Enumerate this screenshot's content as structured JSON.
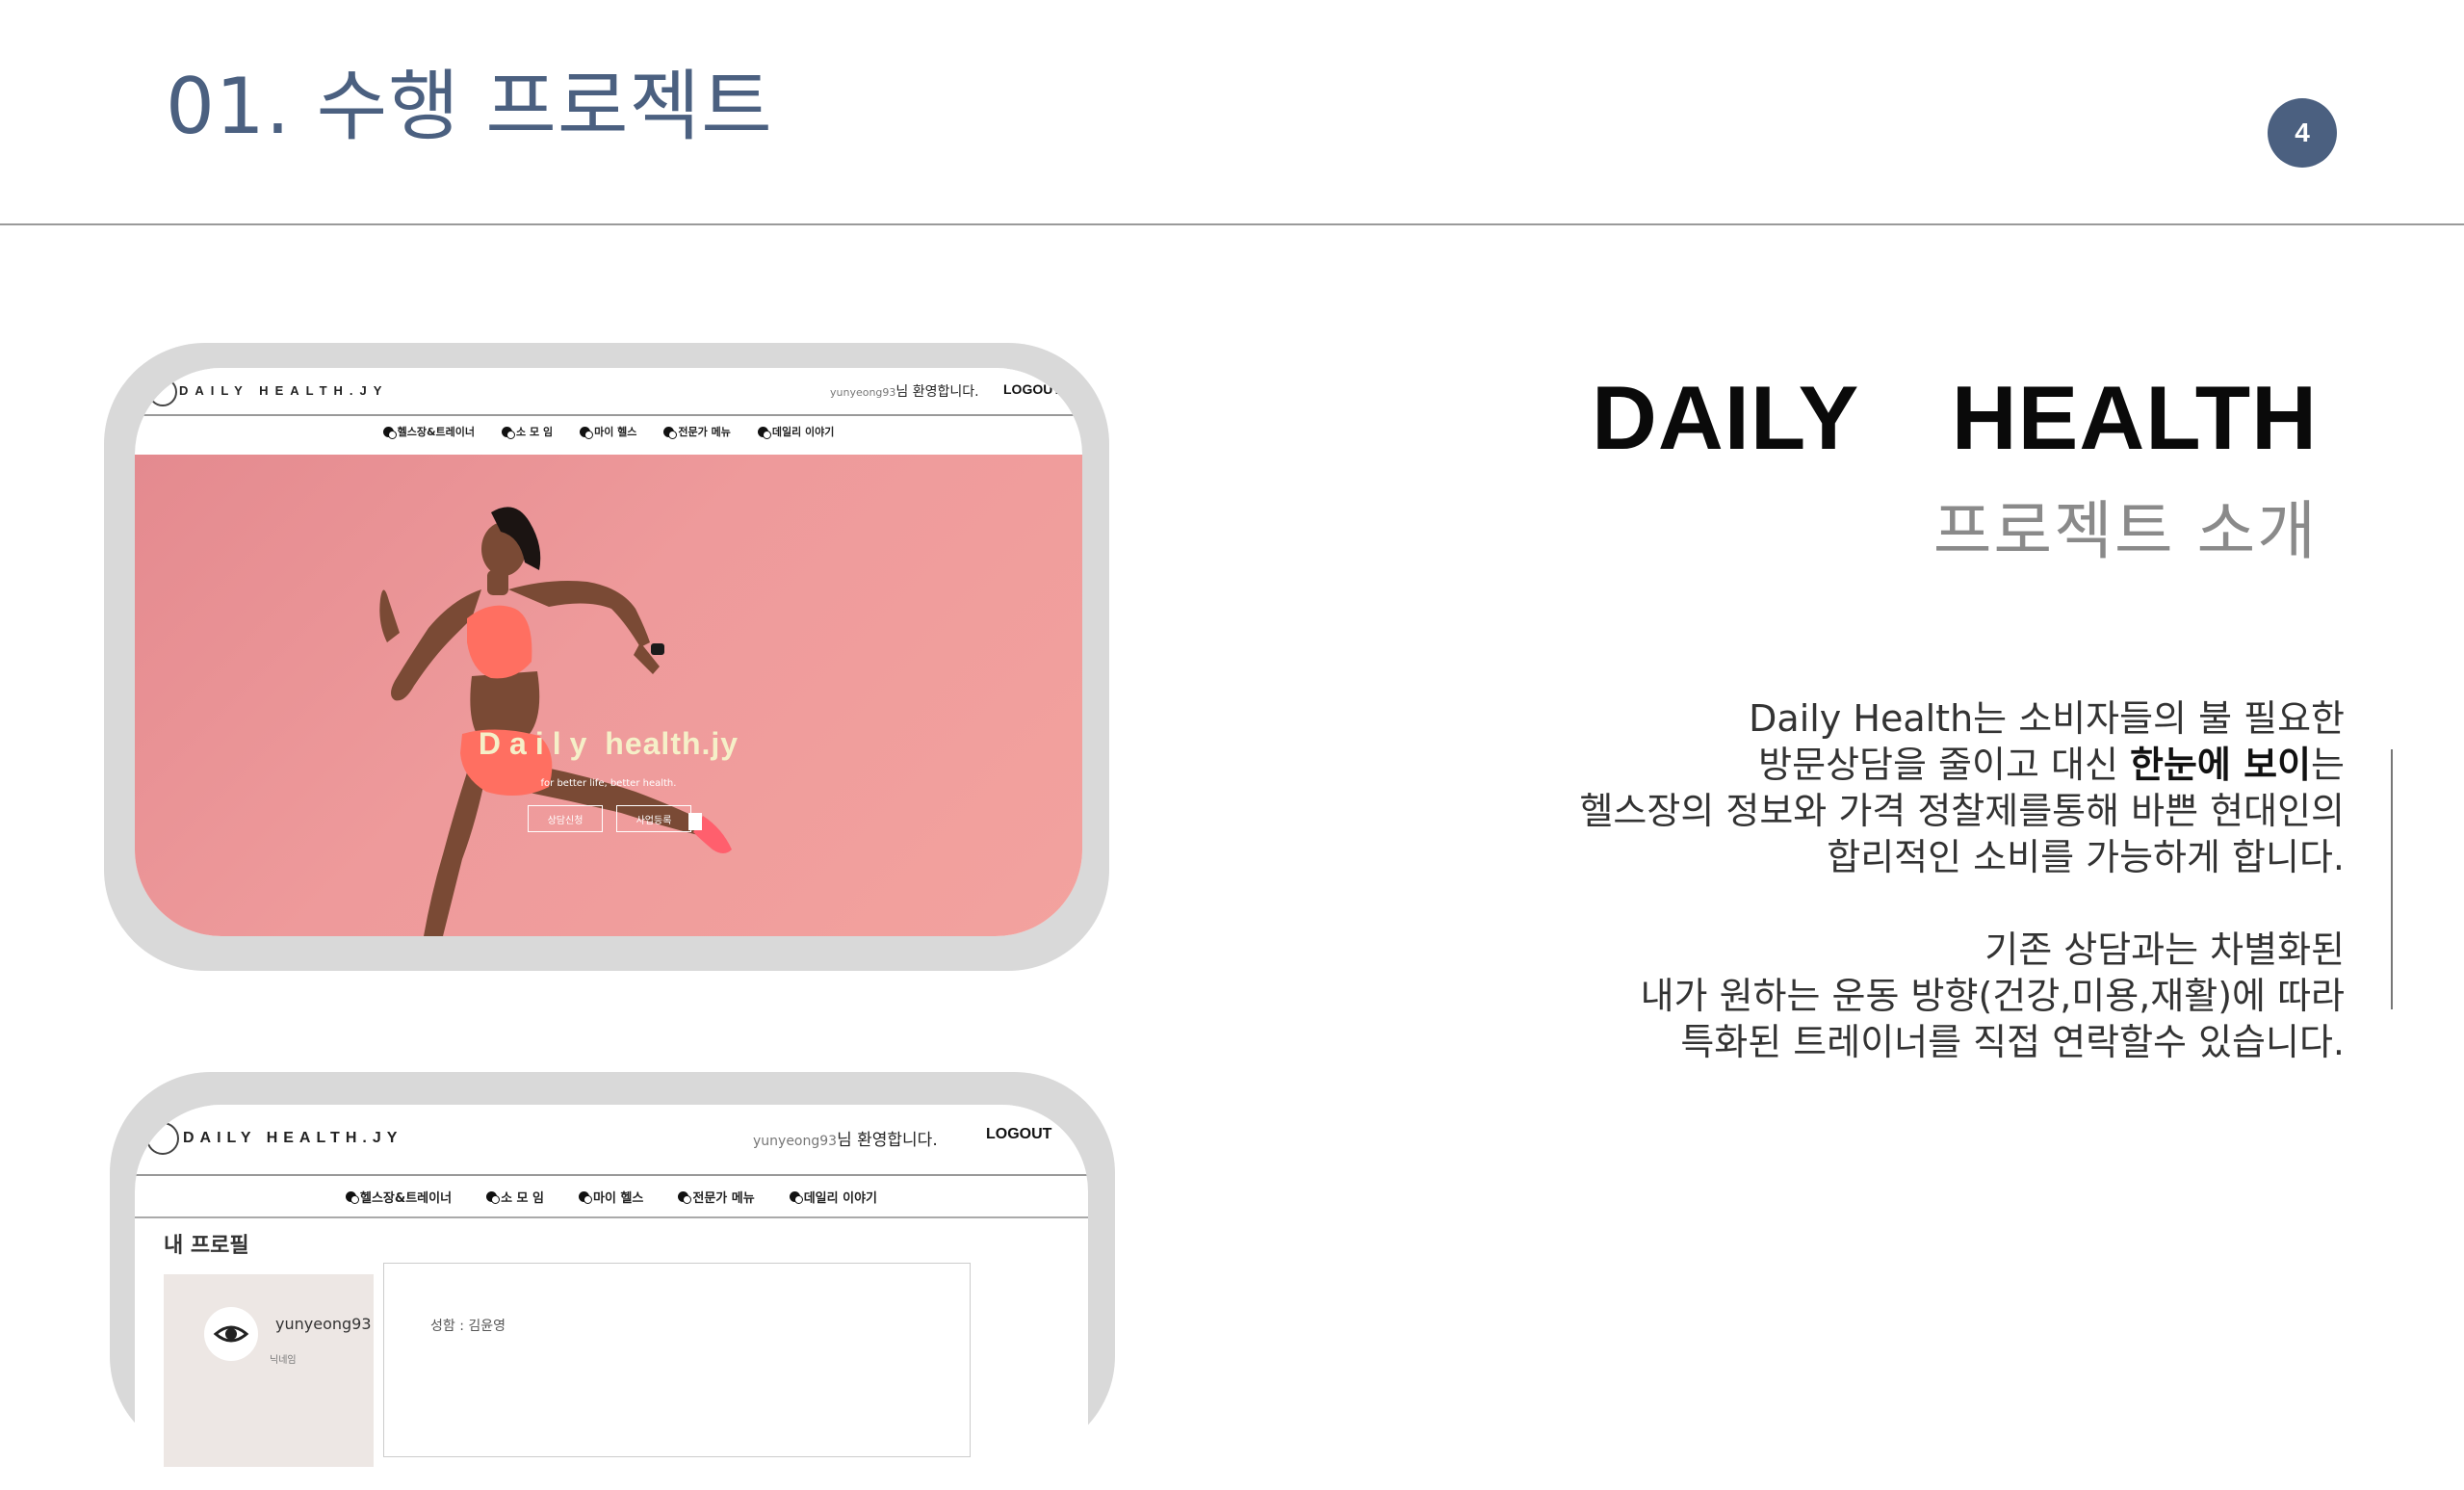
{
  "slide": {
    "title": "01. 수행 프로젝트",
    "page_number": "4"
  },
  "brand": {
    "title": "DAILY HEALTH",
    "subtitle": "프로젝트 소개"
  },
  "description": {
    "p1": {
      "line1": "Daily Health는 소비자들의 불 필요한",
      "line2_pre": "방문상담을 줄이고 대신 ",
      "line2_bold": "한눈에 보이",
      "line2_post": "는",
      "line3": "헬스장의 정보와 가격 정찰제를통해 바쁜 현대인의",
      "line4": "합리적인 소비를 가능하게 합니다."
    },
    "p2": {
      "line1": "기존 상담과는 차별화된",
      "line2": "내가 원하는 운동 방향(건강,미용,재활)에 따라",
      "line3": "특화된 트레이너를 직접 연락할수 있습니다."
    }
  },
  "screenshot1": {
    "logo": "DAILY HEALTH.JY",
    "user": "yunyeong93",
    "welcome": "님 환영합니다.",
    "logout": "LOGOUT",
    "nav": [
      "헬스장&트레이너",
      "소 모 임",
      "마이 헬스",
      "전문가 메뉴",
      "데일리 이야기"
    ],
    "hero_title_spaced": "Daily",
    "hero_title_rest": " health.jy",
    "hero_tagline": "for better life, better health.",
    "btn_consult": "상담신청",
    "btn_register": "사업등록"
  },
  "screenshot2": {
    "logo": "DAILY HEALTH.JY",
    "user": "yunyeong93",
    "welcome": "님 환영합니다.",
    "logout": "LOGOUT",
    "nav": [
      "헬스장&트레이너",
      "소 모 임",
      "마이 헬스",
      "전문가 메뉴",
      "데일리 이야기"
    ],
    "profile_heading": "내 프로필",
    "profile_username": "yunyeong93",
    "profile_nickname": "닉네임",
    "profile_name": "성함 : 김윤영"
  },
  "colors": {
    "title": "#4b6080",
    "hero_pink": "#ee9a9b",
    "frame_gray": "#d9d9d9"
  }
}
